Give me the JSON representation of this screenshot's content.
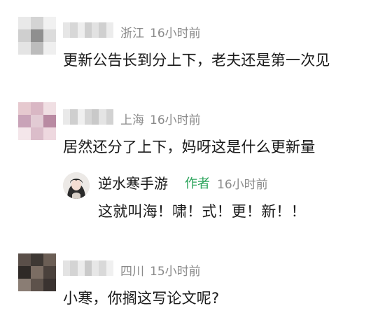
{
  "comments": [
    {
      "location": "浙江",
      "time": "16小时前",
      "text": "更新公告长到分上下，老夫还是第一次见",
      "avatar_colors": [
        "#e9e9e9",
        "#d4d4d4",
        "#f1f1f1",
        "#cfcfcf",
        "#8f8f8f",
        "#dcdcdc",
        "#e4e4e4",
        "#bcbcbc",
        "#efefef"
      ]
    },
    {
      "location": "上海",
      "time": "16小时前",
      "text": "居然还分了上下，妈呀这是什么更新量",
      "avatar_colors": [
        "#e6c9cf",
        "#d9b7c4",
        "#f0dfe3",
        "#c9a3b8",
        "#e2cbd4",
        "#b98aa2",
        "#f4e6ea",
        "#dbbdca",
        "#eed8df"
      ],
      "reply": {
        "author": "逆水寒手游",
        "badge": "作者",
        "time": "16小时前",
        "text": "这就叫海！啸！式！更！新！！"
      }
    },
    {
      "location": "四川",
      "time": "15小时前",
      "text": "小寒，你搁这写论文呢?",
      "avatar_colors": [
        "#5a4f49",
        "#3e3834",
        "#6b5e55",
        "#2f2a27",
        "#7b6d63",
        "#4a413c",
        "#8a7d74",
        "#5d524b",
        "#3a3330"
      ]
    }
  ]
}
